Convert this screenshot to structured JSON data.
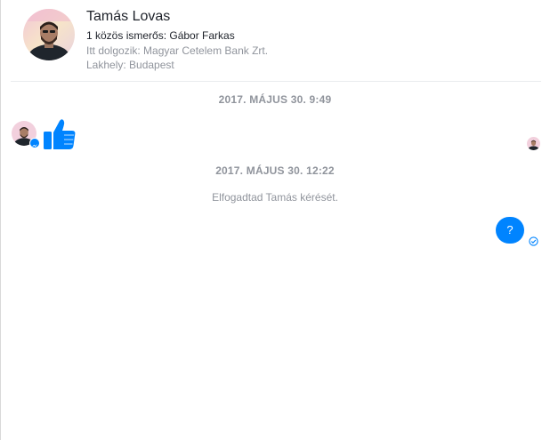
{
  "profile": {
    "name": "Tamás Lovas",
    "mutual_friends": "1 közös ismerős: Gábor Farkas",
    "works_at": "Itt dolgozik: Magyar Cetelem Bank Zrt.",
    "lives_in": "Lakhely: Budapest"
  },
  "conversation": {
    "timestamps": [
      "2017. MÁJUS 30. 9:49",
      "2017. MÁJUS 30. 12:22"
    ],
    "incoming": {
      "type": "like-sticker",
      "icon": "thumbs-up-icon"
    },
    "system_message": "Elfogadtad Tamás kérését.",
    "outgoing": {
      "text": "?",
      "status_icon": "sent-check-icon"
    }
  },
  "colors": {
    "messenger_blue": "#0084ff",
    "primary_text": "#1d2129",
    "secondary_text": "#90949c",
    "divider": "#e9ebee"
  }
}
